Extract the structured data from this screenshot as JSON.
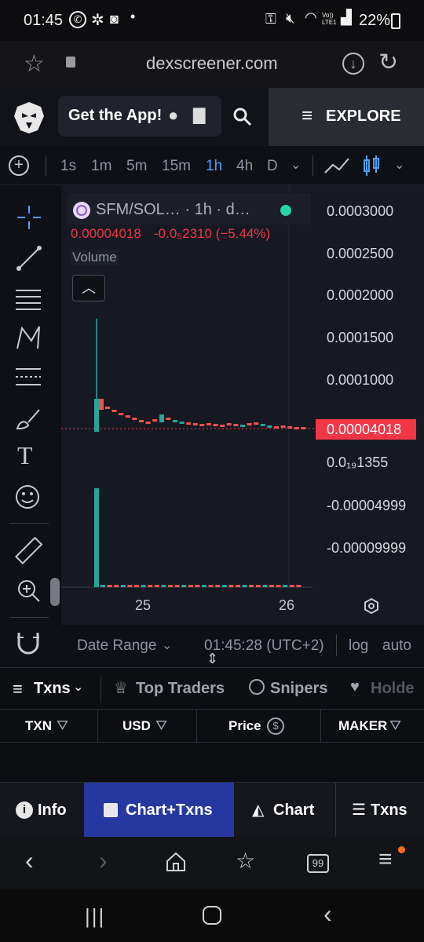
{
  "status_bar": {
    "time": "01:45",
    "lte": "Vo)) LTE1",
    "battery": "22%"
  },
  "browser": {
    "url": "dexscreener.com"
  },
  "header": {
    "get_app": "Get the App!",
    "explore": "EXPLORE"
  },
  "toolbar": {
    "timeframes": [
      "1s",
      "1m",
      "5m",
      "15m",
      "1h",
      "4h",
      "D"
    ],
    "active": "1h"
  },
  "chart": {
    "pair": "SFM/SOL… · 1h · d…",
    "price_line": "0.00004018",
    "change": "-0.0₅2310 (−5.44%)",
    "volume_label": "Volume",
    "price_tag": "0.00004018",
    "y_labels": [
      "0.0003000",
      "0.0002500",
      "0.0002000",
      "0.0001500",
      "0.0001000",
      "0.0₁₉1355",
      "-0.00004999",
      "-0.00009999"
    ],
    "x_labels": [
      "25",
      "26"
    ],
    "colors": {
      "up": "#26a69a",
      "down": "#ef5350",
      "tag": "#f23645",
      "accent": "#2962ff"
    }
  },
  "chart_data": {
    "type": "candlestick",
    "y_ticks": [
      "0.0003000",
      "0.0002500",
      "0.0002000",
      "0.0001500",
      "0.0001000",
      "0.0₁₉1355",
      "-0.00004999",
      "-0.00009999"
    ],
    "x_ticks": [
      "25",
      "26"
    ],
    "last_price": "0.00004018"
  },
  "datebar": {
    "date_range": "Date Range",
    "time": "01:45:28 (UTC+2)",
    "log": "log",
    "auto": "auto"
  },
  "tabs": {
    "txns": "Txns",
    "top_traders": "Top Traders",
    "snipers": "Snipers",
    "holders": "Holde"
  },
  "table_headers": {
    "txn": "TXN",
    "usd": "USD",
    "price": "Price",
    "maker": "MAKER"
  },
  "bottom_tabs": {
    "info": "Info",
    "chart_txns": "Chart+Txns",
    "chart": "Chart",
    "txns": "Txns"
  },
  "browser_nav": {
    "tabs_count": "99"
  }
}
